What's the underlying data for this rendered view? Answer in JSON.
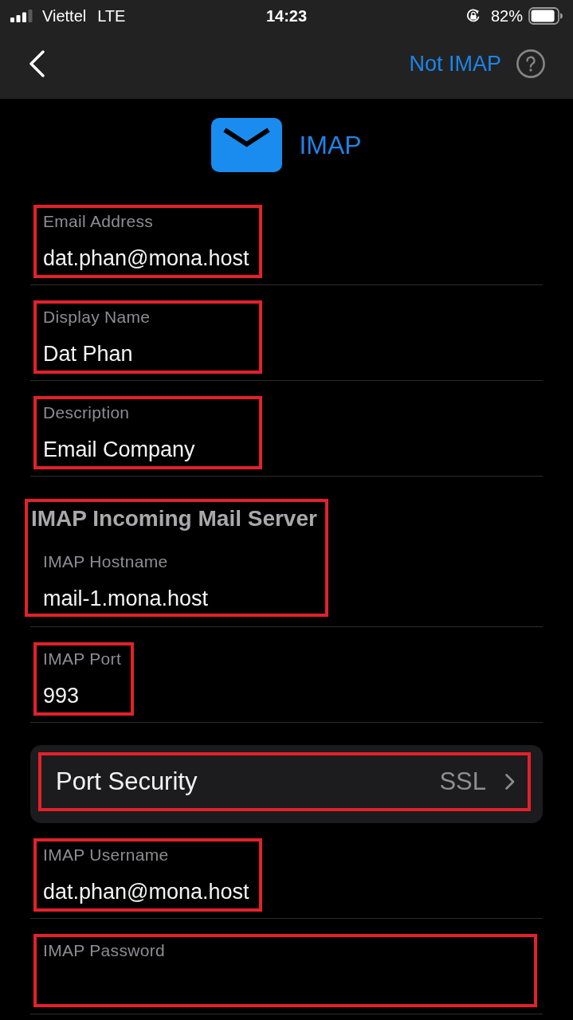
{
  "status_bar": {
    "carrier": "Viettel",
    "network": "LTE",
    "time": "14:23",
    "battery": "82%"
  },
  "nav_bar": {
    "action": "Not IMAP"
  },
  "header": {
    "title": "IMAP"
  },
  "account_fields": [
    {
      "label": "Email Address",
      "value": "dat.phan@mona.host",
      "highlighted": true
    },
    {
      "label": "Display Name",
      "value": "Dat Phan",
      "highlighted": true
    },
    {
      "label": "Description",
      "value": "Email Company",
      "highlighted": true
    }
  ],
  "incoming_server": {
    "heading": "IMAP Incoming Mail Server",
    "highlighted": true,
    "hostname": {
      "label": "IMAP Hostname",
      "value": "mail-1.mona.host"
    }
  },
  "port_fields": [
    {
      "label": "IMAP Port",
      "value": "993",
      "highlighted": true
    }
  ],
  "port_security": {
    "label": "Port Security",
    "value": "SSL",
    "highlighted": true
  },
  "login_fields": [
    {
      "label": "IMAP Username",
      "value": "dat.phan@mona.host",
      "highlighted": true
    },
    {
      "label": "IMAP Password",
      "highlighted": true
    }
  ]
}
